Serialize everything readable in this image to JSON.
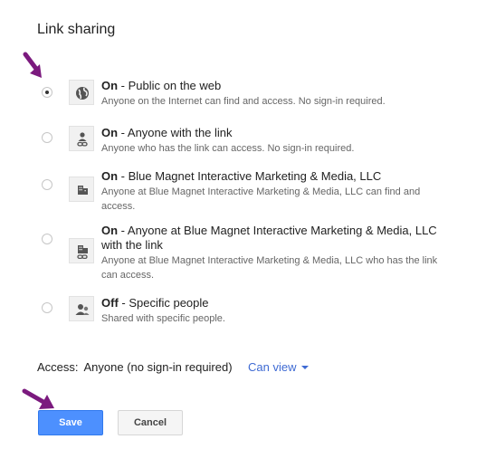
{
  "dialog": {
    "title": "Link sharing"
  },
  "options": [
    {
      "state": "On",
      "label": " - Public on the web",
      "description": "Anyone on the Internet can find and access. No sign-in required.",
      "icon": "globe-icon",
      "selected": true
    },
    {
      "state": "On",
      "label": " - Anyone with the link",
      "description": "Anyone who has the link can access. No sign-in required.",
      "icon": "person-link-icon",
      "selected": false
    },
    {
      "state": "On",
      "label": " - Blue Magnet Interactive Marketing & Media, LLC",
      "description": "Anyone at Blue Magnet Interactive Marketing & Media, LLC can find and access.",
      "icon": "building-icon",
      "selected": false
    },
    {
      "state": "On",
      "label": " - Anyone at Blue Magnet Interactive Marketing & Media, LLC with the link",
      "description": "Anyone at Blue Magnet Interactive Marketing & Media, LLC who has the link can access.",
      "icon": "building-link-icon",
      "selected": false
    },
    {
      "state": "Off",
      "label": " - Specific people",
      "description": "Shared with specific people.",
      "icon": "people-icon",
      "selected": false
    }
  ],
  "access": {
    "label": "Access:",
    "value": "Anyone (no sign-in required)",
    "permission": "Can view"
  },
  "buttons": {
    "save": "Save",
    "cancel": "Cancel"
  },
  "colors": {
    "accent_link": "#3e6ad3",
    "save_button": "#4d90fe",
    "annotation_arrow": "#7b1a7e"
  }
}
